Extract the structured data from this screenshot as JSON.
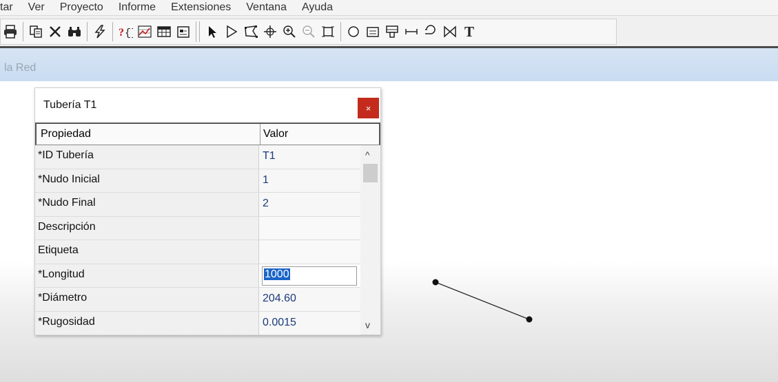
{
  "menubar": {
    "items": [
      "tar",
      "Ver",
      "Proyecto",
      "Informe",
      "Extensiones",
      "Ventana",
      "Ayuda"
    ]
  },
  "toolbar": {
    "groups": [
      [
        "print-icon"
      ],
      [
        "copy-icon",
        "delete-icon",
        "find-icon"
      ],
      [
        "run-icon"
      ],
      [
        "query-icon",
        "graph-icon",
        "table-icon",
        "options-icon"
      ],
      [
        "select-object-icon",
        "select-vertex-icon",
        "select-region-icon",
        "pan-icon",
        "zoom-in-icon",
        "zoom-out-icon",
        "full-extent-icon"
      ],
      [
        "add-junction-icon",
        "add-reservoir-icon",
        "add-tank-icon",
        "add-pipe-icon",
        "add-pump-icon",
        "add-valve-icon",
        "add-label-icon"
      ]
    ],
    "label_tool_glyph": "T"
  },
  "caption": {
    "text": "la Red"
  },
  "dialog": {
    "title": "Tubería T1",
    "close_label": "×",
    "headers": {
      "property": "Propiedad",
      "value": "Valor"
    },
    "rows": [
      {
        "property": "*ID Tubería",
        "value": "T1"
      },
      {
        "property": "*Nudo Inicial",
        "value": "1"
      },
      {
        "property": "*Nudo Final",
        "value": "2"
      },
      {
        "property": "Descripción",
        "value": ""
      },
      {
        "property": "Etiqueta",
        "value": ""
      },
      {
        "property": "*Longitud",
        "value": "1000"
      },
      {
        "property": "*Diámetro",
        "value": "204.60"
      },
      {
        "property": "*Rugosidad",
        "value": "0.0015"
      }
    ],
    "scroll_up": "^",
    "scroll_down": "v"
  },
  "colors": {
    "close_button": "#c42b1c",
    "value_text": "#1c3a7a",
    "selection": "#1a64c8",
    "caption_band": "#c9dcf1"
  }
}
